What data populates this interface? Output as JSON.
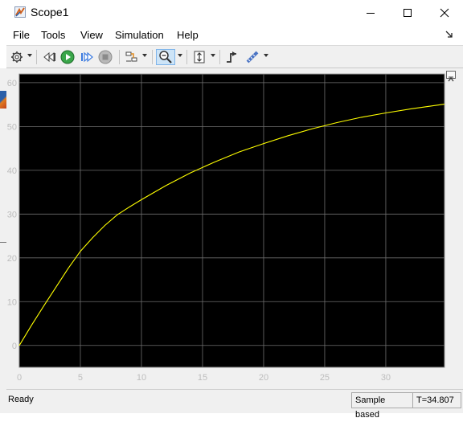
{
  "window": {
    "title": "Scope1",
    "icon": "matlab-scope-icon"
  },
  "menu": [
    "File",
    "Tools",
    "View",
    "Simulation",
    "Help"
  ],
  "toolbar": {
    "icons": [
      "gear-icon",
      "step-back-icon",
      "run-icon",
      "step-forward-icon",
      "stop-icon",
      "signal-selector-icon",
      "zoom-in-icon",
      "autoscale-icon",
      "triggers-icon",
      "measurements-icon"
    ],
    "active_tool": "zoom-in-icon"
  },
  "status": {
    "left": "Ready",
    "mode": "Sample based",
    "time": "T=34.807"
  },
  "colors": {
    "plot_background": "#000000",
    "grid": "#6e6e6e",
    "trace": "#ffff00",
    "tick_labels": "#bdbdbd"
  },
  "chart_data": {
    "type": "line",
    "title": "",
    "xlabel": "",
    "ylabel": "",
    "xlim": [
      0,
      34.807
    ],
    "ylim": [
      -5,
      62
    ],
    "xticks": [
      0,
      5,
      10,
      15,
      20,
      25,
      30
    ],
    "yticks": [
      0,
      10,
      20,
      30,
      40,
      50,
      60
    ],
    "grid": true,
    "series": [
      {
        "x": [
          0,
          1,
          2,
          3,
          4,
          5,
          6,
          7,
          8,
          9,
          10,
          12,
          14,
          16,
          18,
          20,
          22,
          24,
          26,
          28,
          30,
          32,
          34.807
        ],
        "y": [
          0,
          4.6,
          9,
          13.3,
          17.6,
          21.5,
          24.6,
          27.4,
          29.8,
          31.6,
          33.3,
          36.5,
          39.4,
          41.9,
          44.2,
          46.1,
          47.9,
          49.5,
          50.9,
          52.1,
          53.1,
          54.0,
          55.1
        ]
      }
    ]
  }
}
